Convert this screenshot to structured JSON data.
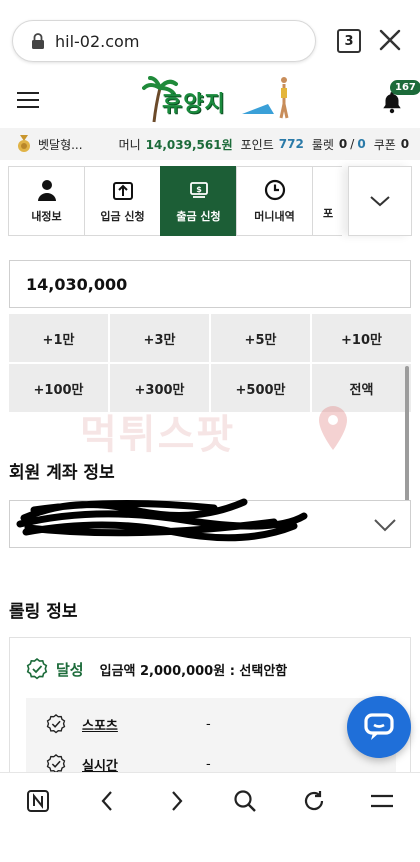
{
  "browser": {
    "url": "hil-02.com",
    "tab_count": "3"
  },
  "header": {
    "logo_text": "휴양지",
    "notification_count": "167"
  },
  "info_strip": {
    "user": "벳달형...",
    "money_label": "머니",
    "money_value": "14,039,561원",
    "point_label": "포인트",
    "point_value": "772",
    "roulette_label": "룰렛",
    "roulette_used": "0",
    "roulette_sep": "/",
    "roulette_total": "0",
    "coupon_label": "쿠폰",
    "coupon_value": "0"
  },
  "tabs": [
    {
      "label": "내정보",
      "icon": "user-icon"
    },
    {
      "label": "입금 신청",
      "icon": "deposit-icon"
    },
    {
      "label": "출금 신청",
      "icon": "withdraw-icon",
      "active": true
    },
    {
      "label": "머니내역",
      "icon": "clock-icon"
    },
    {
      "label": "포",
      "icon": "partial"
    }
  ],
  "amount": {
    "value": "14,030,000"
  },
  "amount_buttons": [
    "+1만",
    "+3만",
    "+5만",
    "+10만",
    "+100만",
    "+300만",
    "+500만",
    "전액"
  ],
  "watermark": "먹튀스팟",
  "account": {
    "title": "회원 계좌 정보"
  },
  "rolling": {
    "title": "롤링 정보",
    "status": "달성",
    "deposit_text": "입금액 2,000,000원 : 선택안함",
    "items": [
      {
        "name": "스포츠",
        "value": "-"
      },
      {
        "name": "실시간",
        "value": "-"
      }
    ]
  },
  "colors": {
    "brand_green": "#1c5e36",
    "chat_blue": "#1f6fd9"
  }
}
